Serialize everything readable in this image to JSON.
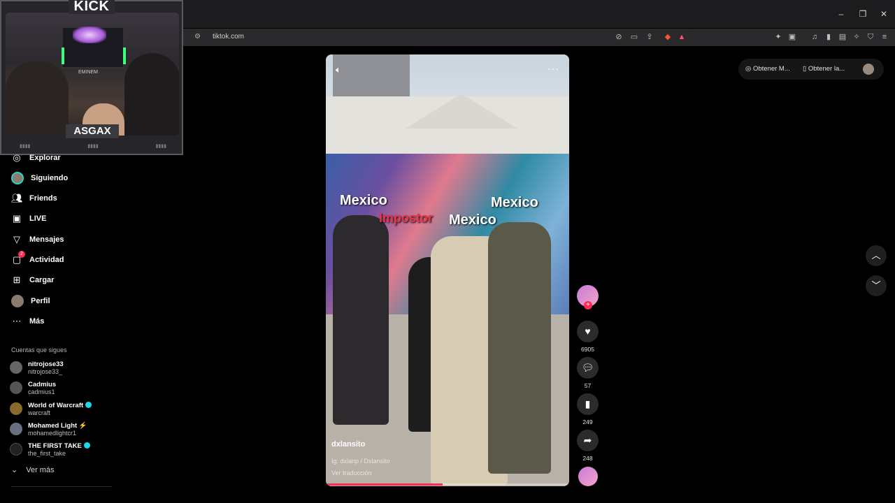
{
  "browser": {
    "url": "tiktok.com",
    "window_controls": [
      "–",
      "❐",
      "✕"
    ]
  },
  "overlay": {
    "brand": "KICK",
    "streamer": "ASGAX",
    "shelf_label": "EMINEM"
  },
  "sidebar": {
    "nav": [
      {
        "label": "Explorar",
        "icon": "compass-icon"
      },
      {
        "label": "Siguiendo",
        "icon": "avatar"
      },
      {
        "label": "Friends",
        "icon": "users-icon"
      },
      {
        "label": "LIVE",
        "icon": "tv-icon"
      },
      {
        "label": "Mensajes",
        "icon": "send-icon"
      },
      {
        "label": "Actividad",
        "icon": "inbox-icon",
        "badge": "2"
      },
      {
        "label": "Cargar",
        "icon": "plus-square-icon"
      },
      {
        "label": "Perfil",
        "icon": "avatar"
      },
      {
        "label": "Más",
        "icon": "dots-icon"
      }
    ],
    "following_title": "Cuentas que sigues",
    "following": [
      {
        "name": "nitrojose33",
        "user": "nitrojose33_"
      },
      {
        "name": "Cadmius",
        "user": "cadmius1"
      },
      {
        "name": "World of Warcraft",
        "user": "warcraft",
        "verified": true
      },
      {
        "name": "Mohamed Light ⚡",
        "user": "mohamedlightcr1"
      },
      {
        "name": "THE FIRST TAKE",
        "user": "the_first_take",
        "verified": true
      }
    ],
    "see_more": "Ver más"
  },
  "video": {
    "captions": [
      "Mexico",
      "Impostor",
      "Mexico",
      "Mexico"
    ],
    "author": "dxlansito",
    "description": "Ig: dxlanp / Dxlansito",
    "translate": "Ver traducción",
    "progress": 0.48
  },
  "actions": {
    "likes": "6905",
    "comments": "57",
    "saves": "249",
    "shares": "248"
  },
  "topright": {
    "item1": "Obtener M...",
    "item2": "Obtener la..."
  }
}
